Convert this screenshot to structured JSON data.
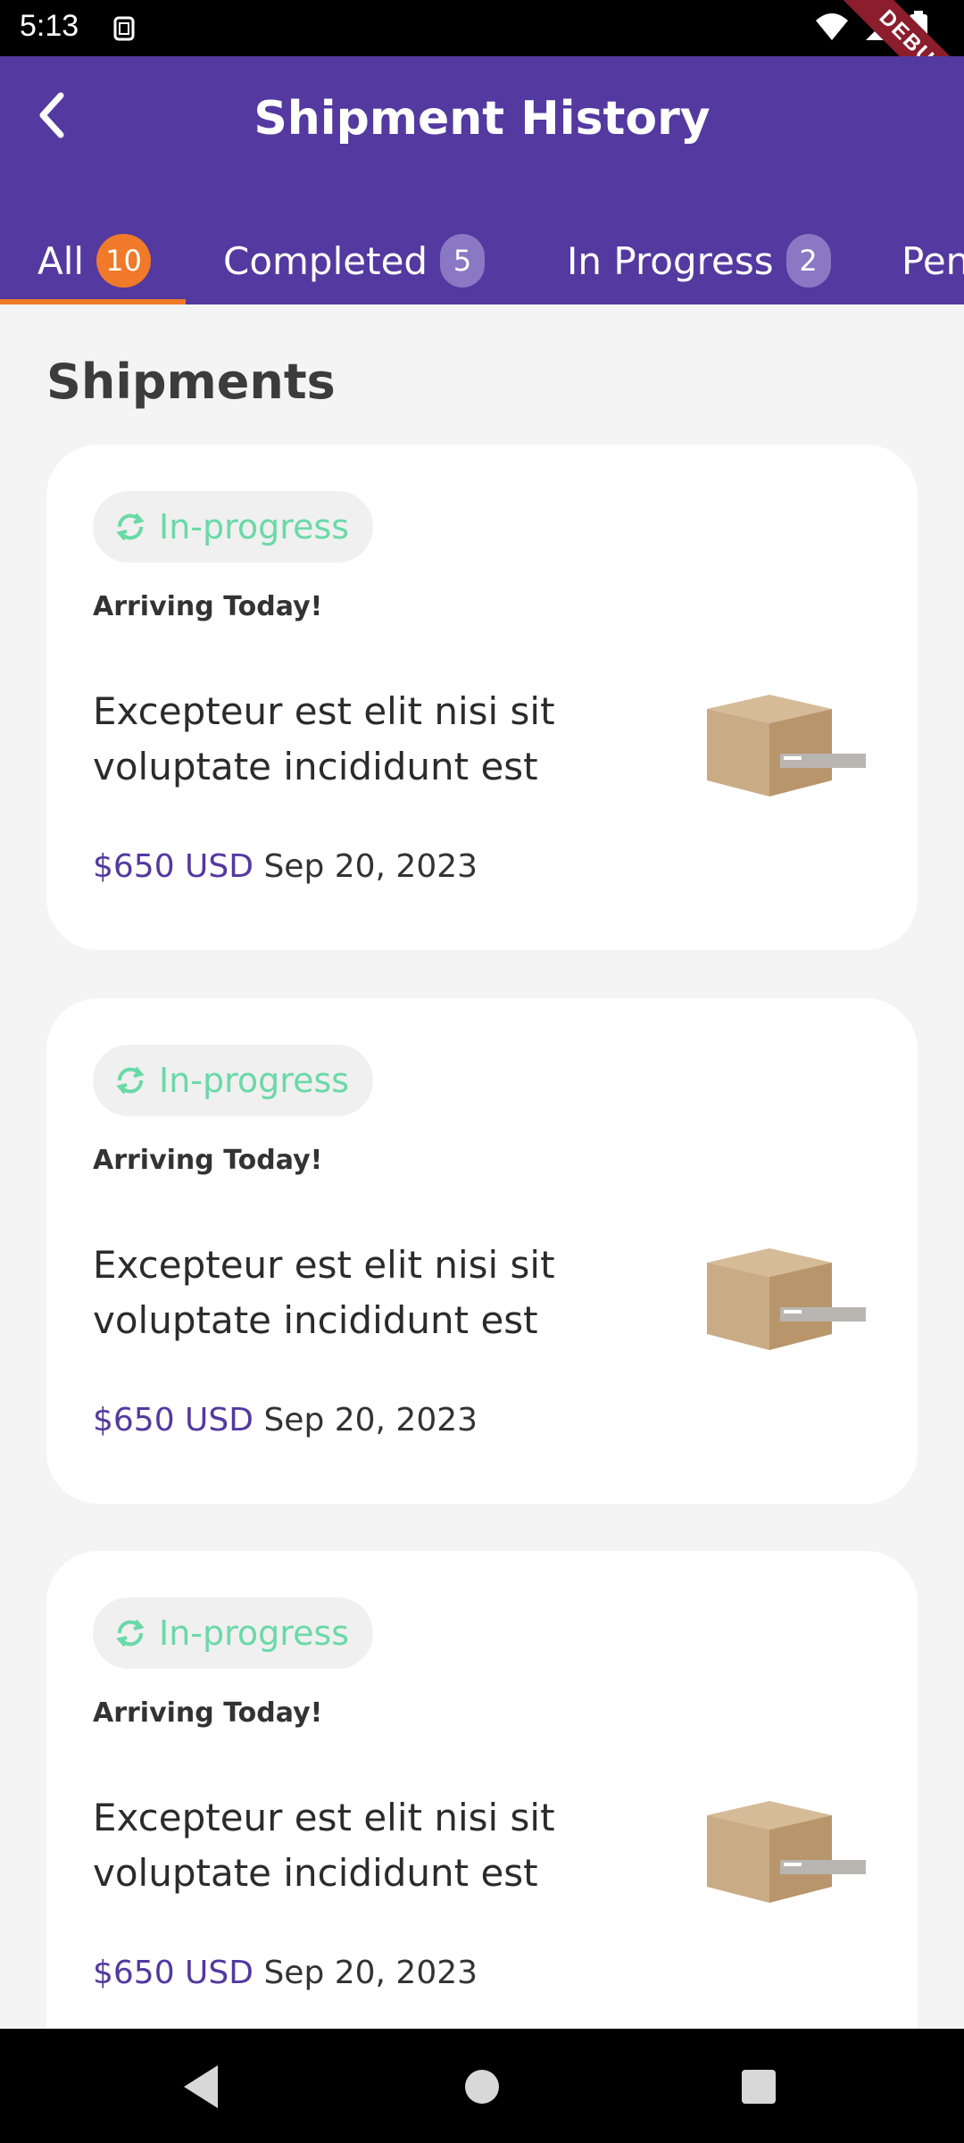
{
  "status_bar": {
    "time": "5:13",
    "debug_label": "DEBUG"
  },
  "app_bar": {
    "title": "Shipment History",
    "back_icon": "chevron-left-icon"
  },
  "tabs": [
    {
      "label": "All",
      "count": "10",
      "active": true
    },
    {
      "label": "Completed",
      "count": "5",
      "active": false
    },
    {
      "label": "In Progress",
      "count": "2",
      "active": false
    },
    {
      "label": "Pen",
      "count": "",
      "active": false
    }
  ],
  "section_title": "Shipments",
  "shipments": [
    {
      "status": "In-progress",
      "headline": "Arriving Today!",
      "description": "Excepteur est elit nisi sit voluptate incididunt est",
      "price": "$650 USD",
      "date": "Sep 20, 2023",
      "image": "cardboard-box-image"
    },
    {
      "status": "In-progress",
      "headline": "Arriving Today!",
      "description": "Excepteur est elit nisi sit voluptate incididunt est",
      "price": "$650 USD",
      "date": "Sep 20, 2023",
      "image": "cardboard-box-image"
    },
    {
      "status": "In-progress",
      "headline": "Arriving Today!",
      "description": "Excepteur est elit nisi sit voluptate incididunt est",
      "price": "$650 USD",
      "date": "Sep 20, 2023",
      "image": "cardboard-box-image"
    }
  ],
  "colors": {
    "primary": "#5339a0",
    "accent": "#f07a2a",
    "status_green": "#6ad9a7",
    "background": "#f4f4f4"
  }
}
